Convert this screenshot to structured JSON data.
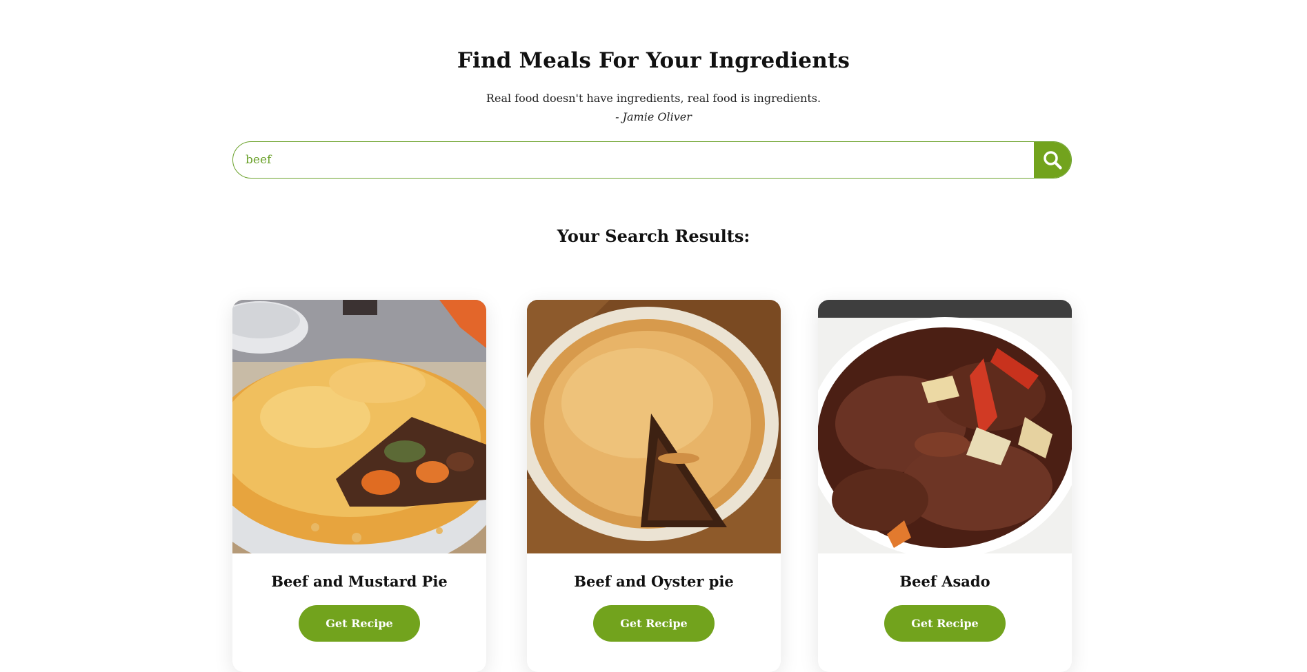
{
  "header": {
    "title": "Find Meals For Your Ingredients",
    "quote": "Real food doesn't have ingredients, real food is ingredients.",
    "author": "- Jamie Oliver"
  },
  "search": {
    "value": "beef",
    "button_icon": "search-icon"
  },
  "results": {
    "title": "Your Search Results:",
    "button_label": "Get Recipe",
    "items": [
      {
        "name": "Beef and Mustard Pie",
        "image": "meal-photo"
      },
      {
        "name": "Beef and Oyster pie",
        "image": "meal-photo"
      },
      {
        "name": "Beef Asado",
        "image": "meal-photo"
      }
    ]
  },
  "colors": {
    "accent": "#72a31d",
    "border": "#6aa12a",
    "text": "#111111",
    "background": "#ffffff"
  }
}
